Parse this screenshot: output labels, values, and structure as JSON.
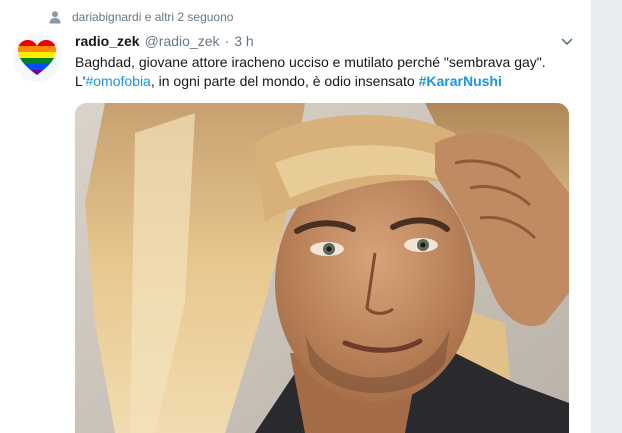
{
  "context": {
    "text": "dariabignardi e altri 2 seguono",
    "icon": "person-icon"
  },
  "tweet": {
    "name": "radio_zek",
    "handle": "@radio_zek",
    "separator": "·",
    "time": "3 h",
    "line1": "Baghdad, giovane attore iracheno ucciso e mutilato perché \"sembrava gay\".",
    "line2_prefix": "L'",
    "hashtag1": "#omofobia",
    "line2_middle": ", in ogni parte del mondo, è odio insensato ",
    "hashtag2": "#KararNushi"
  },
  "colors": {
    "link": "#1b95e0",
    "secondary_text": "#657786",
    "primary_text": "#14171a"
  },
  "icons": {
    "avatar": "rainbow-heart-icon",
    "more": "chevron-down-icon"
  }
}
